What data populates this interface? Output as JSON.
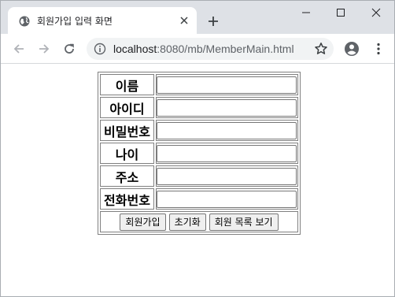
{
  "browser": {
    "tab_title": "회원가입 입력 화면",
    "url_host": "localhost",
    "url_rest": ":8080/mb/MemberMain.html"
  },
  "form": {
    "fields": [
      {
        "label": "이름",
        "value": ""
      },
      {
        "label": "아이디",
        "value": ""
      },
      {
        "label": "비밀번호",
        "value": ""
      },
      {
        "label": "나이",
        "value": ""
      },
      {
        "label": "주소",
        "value": ""
      },
      {
        "label": "전화번호",
        "value": ""
      }
    ],
    "buttons": {
      "join": "회원가입",
      "reset": "초기화",
      "list": "회원 목록 보기"
    }
  },
  "colors": {
    "tabstrip_bg": "#dee1e6",
    "omnibox_bg": "#f1f3f4",
    "table_border": "#808080"
  },
  "icons": [
    "globe-icon",
    "close-icon",
    "plus-icon",
    "minimize-icon",
    "maximize-icon",
    "window-close-icon",
    "back-arrow-icon",
    "forward-arrow-icon",
    "reload-icon",
    "info-icon",
    "star-icon",
    "profile-icon",
    "kebab-menu-icon"
  ]
}
